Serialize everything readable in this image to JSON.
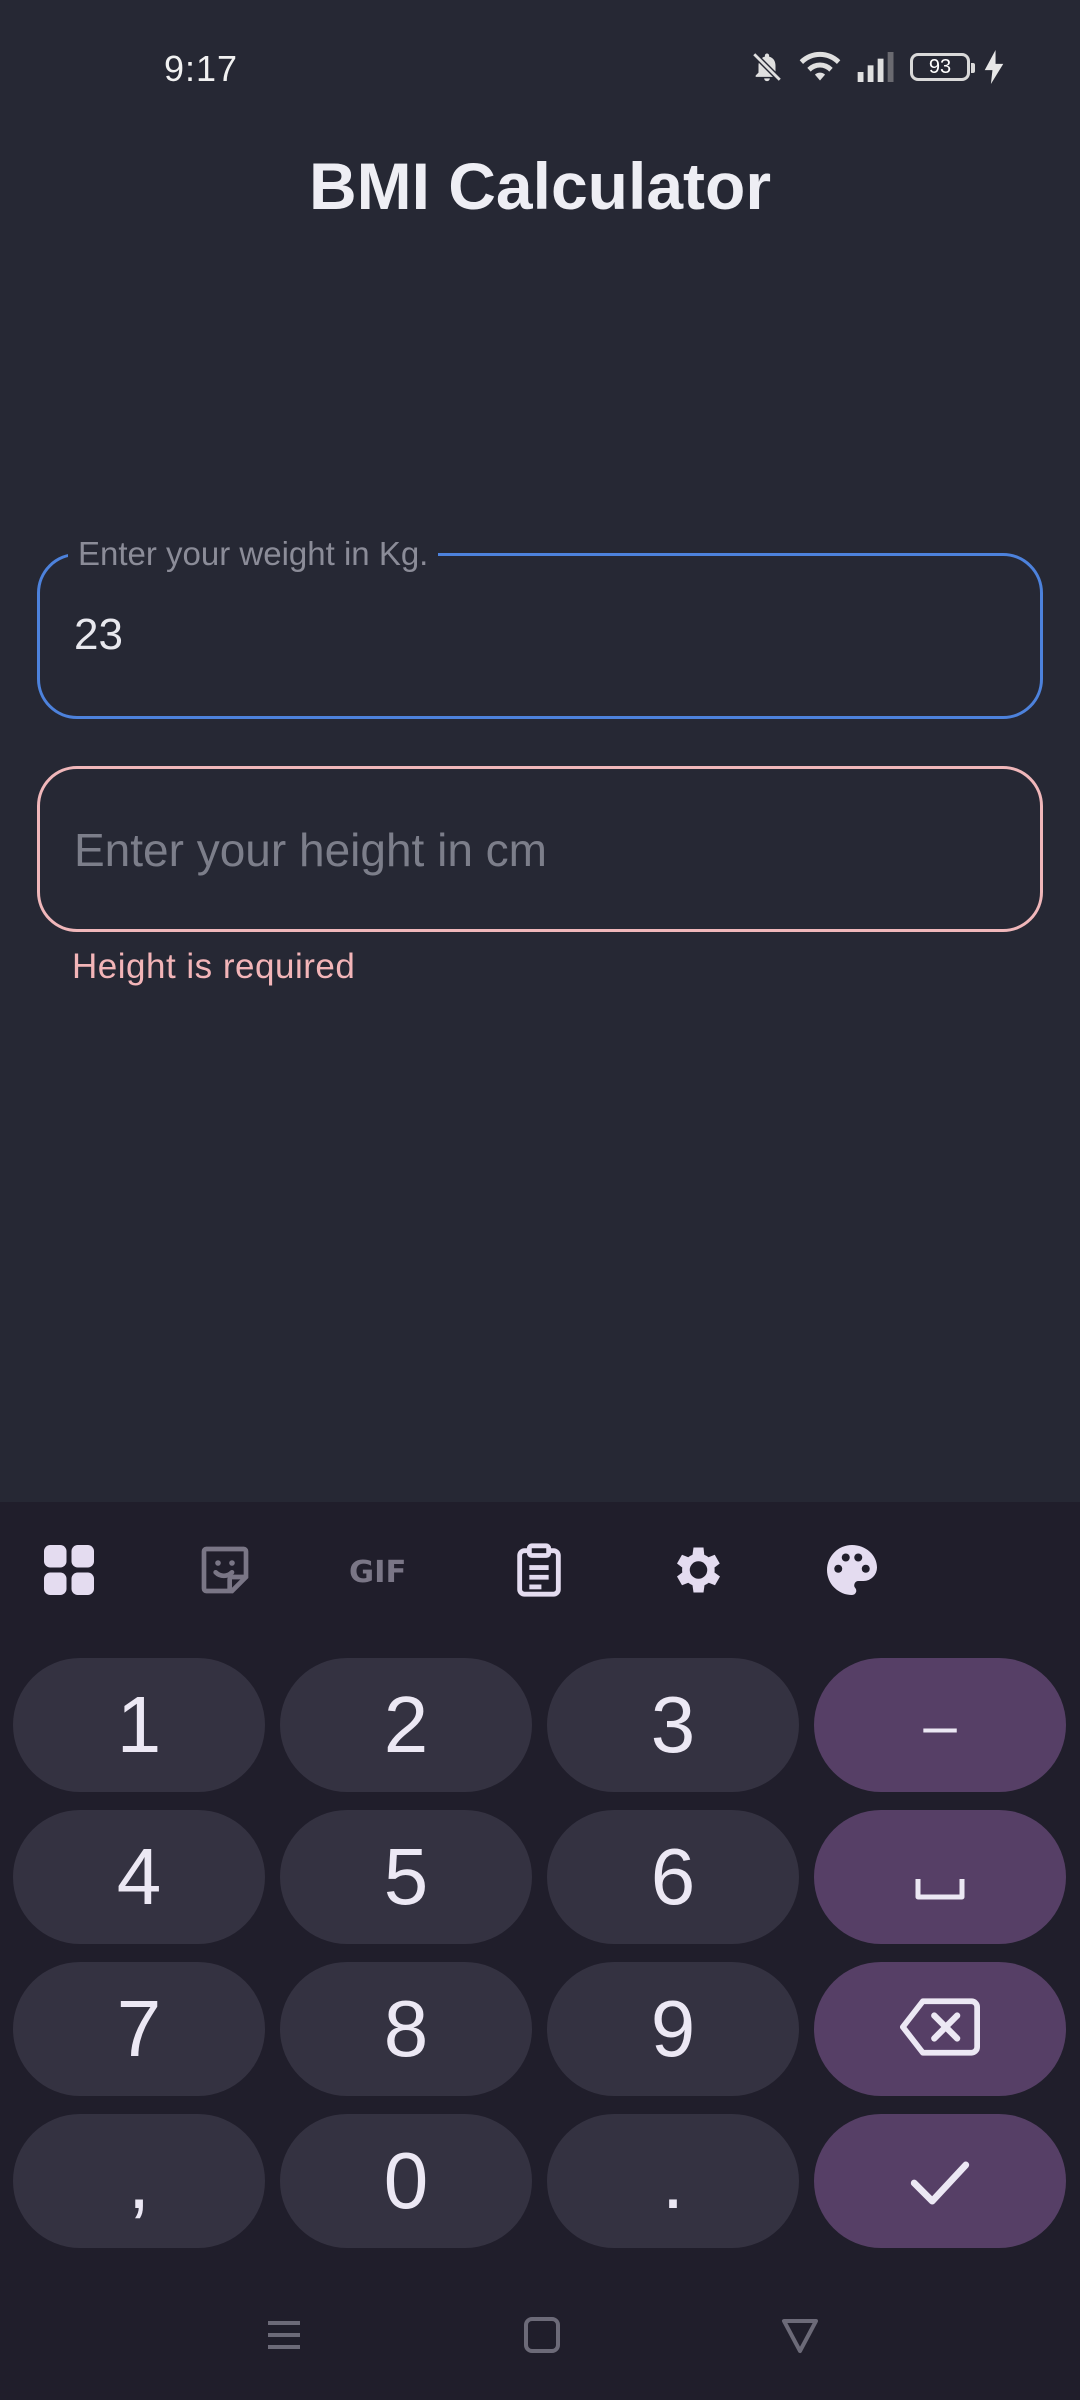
{
  "status_bar": {
    "time": "9:17",
    "battery_level": "93",
    "icons": [
      "bell-off-icon",
      "wifi-icon",
      "signal-icon",
      "battery-icon",
      "charging-bolt-icon"
    ]
  },
  "app": {
    "title": "BMI Calculator"
  },
  "form": {
    "weight": {
      "label": "Enter your weight in Kg.",
      "value": "23",
      "border_color": "#4d82dc"
    },
    "height": {
      "placeholder": "Enter your height in cm",
      "value": "",
      "error": "Height is required",
      "border_color": "#f0b7ba"
    }
  },
  "keyboard": {
    "toolbar": [
      "apps-grid-icon",
      "sticker-icon",
      "gif-icon",
      "clipboard-icon",
      "settings-icon",
      "palette-icon"
    ],
    "keys": {
      "k1": "1",
      "k2": "2",
      "k3": "3",
      "k4": "4",
      "k5": "5",
      "k6": "6",
      "k7": "7",
      "k8": "8",
      "k9": "9",
      "comma": ",",
      "k0": "0",
      "period": ".",
      "minus": "–",
      "space": "␣"
    },
    "key_color": "#343241",
    "function_key_color": "#563f66"
  },
  "nav_bar": {
    "buttons": [
      "menu-icon",
      "home-icon",
      "back-icon"
    ]
  }
}
